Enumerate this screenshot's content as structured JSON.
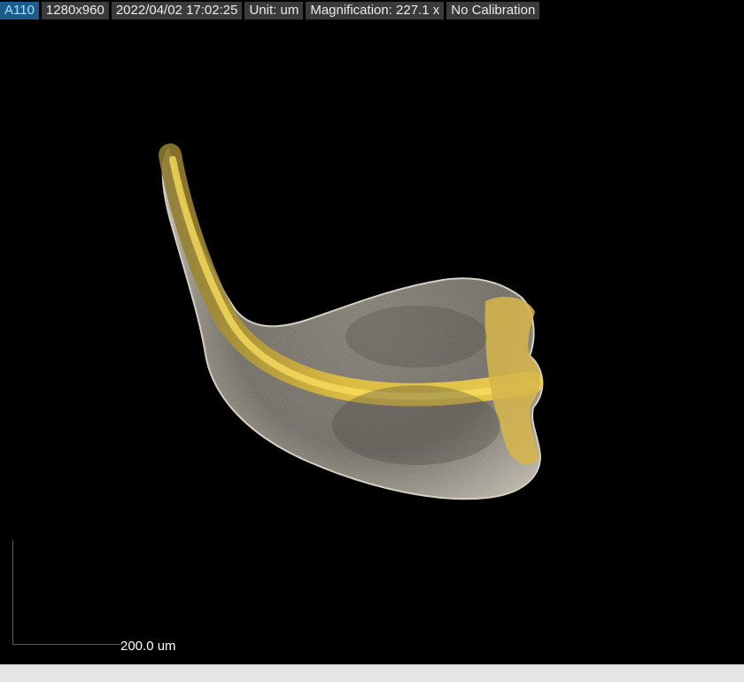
{
  "info_bar": {
    "device": "A110",
    "resolution": "1280x960",
    "timestamp": "2022/04/02 17:02:25",
    "unit": "Unit: um",
    "magnification": "Magnification:  227.1 x",
    "calibration": "No Calibration"
  },
  "scale_bar": {
    "label": "200.0 um"
  },
  "colors": {
    "background": "#000000",
    "chip_background": "#3a3a3a",
    "device_chip_background": "#1e5a8c",
    "device_chip_text": "#9fe6ff",
    "specimen_midrib": "#d9b53a",
    "specimen_tissue": "#8a8578",
    "status_bar": "#e6e6e6"
  }
}
